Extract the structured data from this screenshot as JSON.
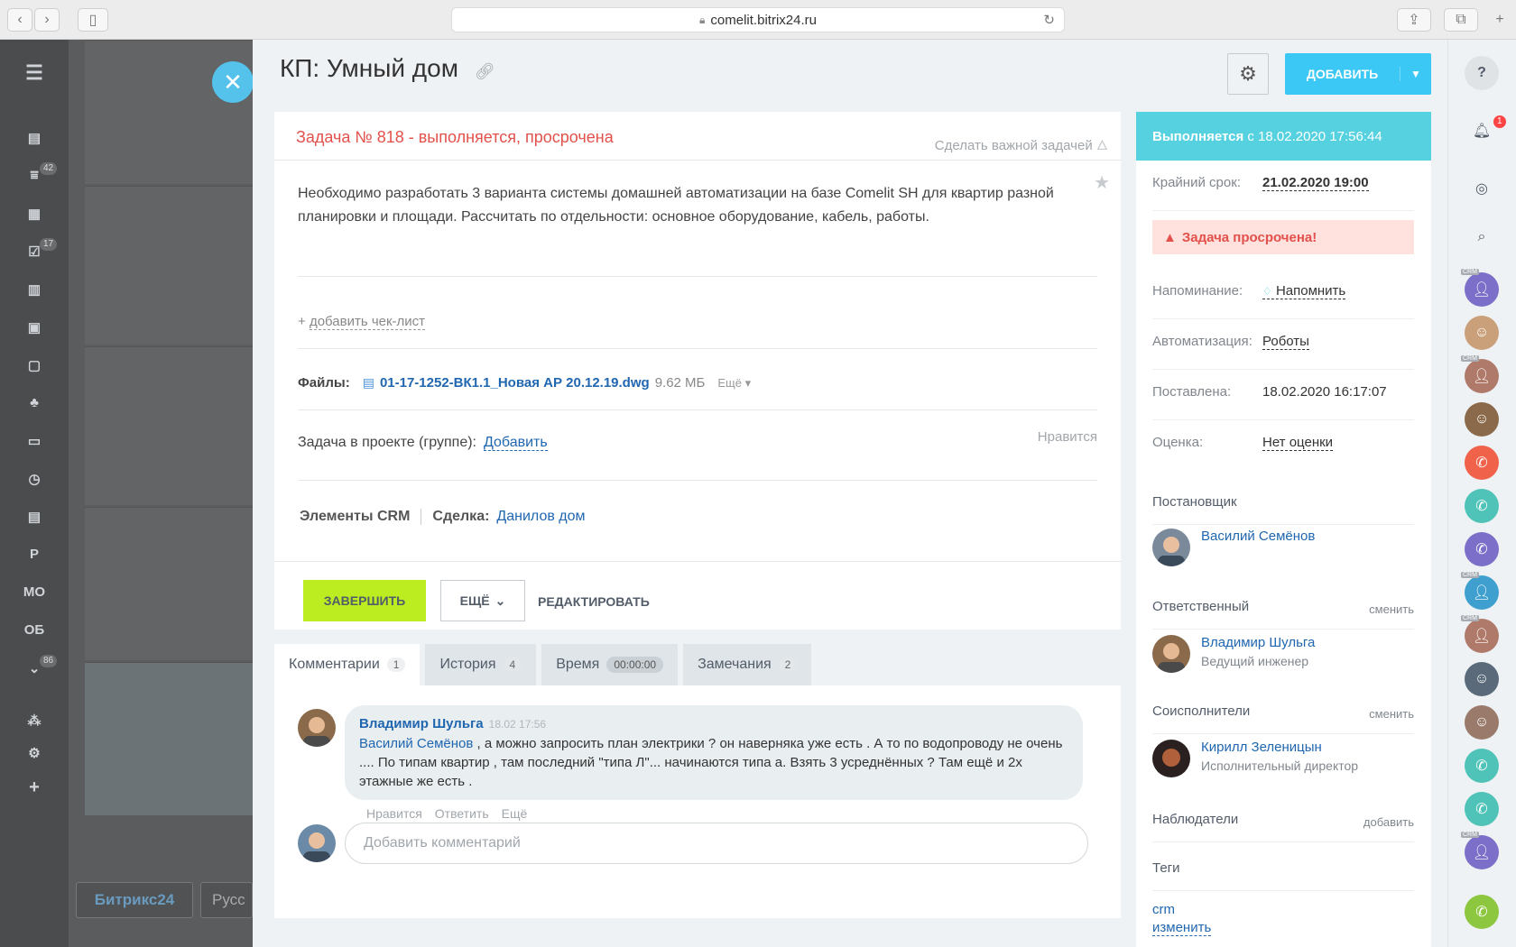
{
  "browser": {
    "url": "comelit.bitrix24.ru"
  },
  "left_nav": {
    "badges": {
      "filter": "42",
      "tasks": "17",
      "more": "86"
    },
    "letters": [
      "Р",
      "МО",
      "ОБ"
    ]
  },
  "background": {
    "logo": "Битрикс24",
    "lang": "Русс"
  },
  "header": {
    "title": "КП: Умный дом",
    "add_button": "ДОБАВИТЬ"
  },
  "task": {
    "header": "Задача № 818 - выполняется, просрочена",
    "make_important": "Сделать важной задачей",
    "description": "Необходимо разработать 3 варианта системы домашней автоматизации на базе Comelit SH для квартир разной планировки и площади. Рассчитать по отдельности: основное оборудование, кабель, работы.",
    "checklist_prefix": "+",
    "checklist": "добавить чек-лист",
    "files_label": "Файлы:",
    "file_name": "01-17-1252-ВК1.1_Новая АР 20.12.19.dwg",
    "file_size": "9.62 МБ",
    "file_more": "Ещё",
    "project_label": "Задача в проекте (группе):",
    "project_add": "Добавить",
    "like": "Нравится",
    "crm_label": "Элементы CRM",
    "deal_label": "Сделка:",
    "deal_value": "Данилов дом"
  },
  "actions": {
    "complete": "ЗАВЕРШИТЬ",
    "more": "ЕЩЁ",
    "edit": "РЕДАКТИРОВАТЬ"
  },
  "tabs": [
    {
      "label": "Комментарии",
      "count": "1"
    },
    {
      "label": "История",
      "count": "4"
    },
    {
      "label": "Время",
      "count": "00:00:00"
    },
    {
      "label": "Замечания",
      "count": "2"
    }
  ],
  "comment": {
    "author": "Владимир Шульга",
    "date": "18.02 17:56",
    "mention": "Василий Семёнов",
    "text": ", а можно запросить план электрики ? он наверняка уже есть . А то по водопроводу не очень .... По типам квартир , там последний \"типа Л\"... начинаются типа а. Взять 3 усреднённых ? Там ещё и 2х этажные же есть .",
    "actions": [
      "Нравится",
      "Ответить",
      "Ещё"
    ],
    "input_placeholder": "Добавить комментарий"
  },
  "info": {
    "status": "Выполняется",
    "status_since": "с 18.02.2020 17:56:44",
    "deadline_label": "Крайний срок:",
    "deadline": "21.02.2020 19:00",
    "overdue": "Задача просрочена!",
    "reminder_label": "Напоминание:",
    "reminder": "Напомнить",
    "automation_label": "Автоматизация:",
    "automation": "Роботы",
    "created_label": "Поставлена:",
    "created": "18.02.2020 16:17:07",
    "rating_label": "Оценка:",
    "rating": "Нет оценки",
    "creator_label": "Постановщик",
    "creator": "Василий Семёнов",
    "responsible_label": "Ответственный",
    "change": "сменить",
    "responsible": "Владимир Шульга",
    "responsible_role": "Ведущий инженер",
    "coexec_label": "Соисполнители",
    "coexec": "Кирилл Зеленицын",
    "coexec_role": "Исполнительный директор",
    "observers_label": "Наблюдатели",
    "add": "добавить",
    "tags_label": "Теги",
    "tag": "crm",
    "tags_edit": "изменить"
  },
  "right_bar": {
    "notifications": "1",
    "crm_tag": "CRM"
  },
  "colors": {
    "accent": "#3bc8f5",
    "complete": "#bbed21",
    "overdue": "#e2514b",
    "status": "#56d1e0"
  }
}
